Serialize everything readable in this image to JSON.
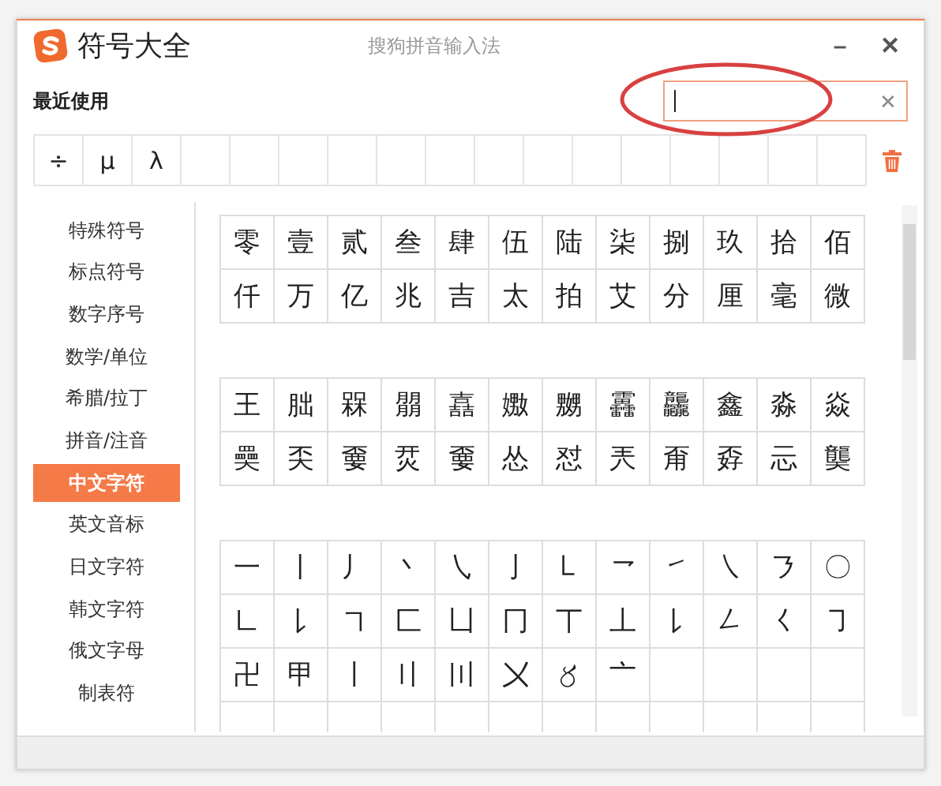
{
  "window": {
    "title": "符号大全",
    "subtitle": "搜狗拼音输入法",
    "minimize": "–",
    "close": "✕"
  },
  "recent": {
    "label": "最近使用",
    "symbols": [
      "÷",
      "μ",
      "λ"
    ]
  },
  "search": {
    "clear": "✕",
    "highlighted": true
  },
  "sidebar": {
    "items": [
      {
        "label": "特殊符号",
        "selected": false
      },
      {
        "label": "标点符号",
        "selected": false
      },
      {
        "label": "数字序号",
        "selected": false
      },
      {
        "label": "数学/单位",
        "selected": false
      },
      {
        "label": "希腊/拉丁",
        "selected": false
      },
      {
        "label": "拼音/注音",
        "selected": false
      },
      {
        "label": "中文字符",
        "selected": true
      },
      {
        "label": "英文音标",
        "selected": false
      },
      {
        "label": "日文字符",
        "selected": false
      },
      {
        "label": "韩文字符",
        "selected": false
      },
      {
        "label": "俄文字母",
        "selected": false
      },
      {
        "label": "制表符",
        "selected": false
      }
    ]
  },
  "groups": [
    {
      "rows": [
        [
          "零",
          "壹",
          "贰",
          "叁",
          "肆",
          "伍",
          "陆",
          "柒",
          "捌",
          "玖",
          "拾",
          "佰"
        ],
        [
          "仟",
          "万",
          "亿",
          "兆",
          "吉",
          "太",
          "拍",
          "艾",
          "分",
          "厘",
          "毫",
          "微"
        ]
      ]
    },
    {
      "rows": [
        [
          "王",
          "朏",
          "槑",
          "朤",
          "嚞",
          "嫐",
          "嬲",
          "靐",
          "龘",
          "鑫",
          "淼",
          "焱"
        ],
        [
          "奰",
          "奀",
          "嫑",
          "烎",
          "嫑",
          "怂",
          "怼",
          "兲",
          "甭",
          "孬",
          "忈",
          "龑"
        ]
      ]
    },
    {
      "rows": [
        [
          "一",
          "丨",
          "丿",
          "丶",
          "㇂",
          "亅",
          "㇄",
          "㇖",
          "㇀",
          "㇏",
          "㇋",
          "〇"
        ],
        [
          "㇗",
          "㇙",
          "㇕",
          "匚",
          "凵",
          "冂",
          "丅",
          "丄",
          "㇙",
          "㇜",
          "㇛",
          "㇆"
        ],
        [
          "卍",
          "甲",
          "〡",
          "〢",
          "〣",
          "〤",
          "〥",
          "〦"
        ]
      ]
    }
  ]
}
